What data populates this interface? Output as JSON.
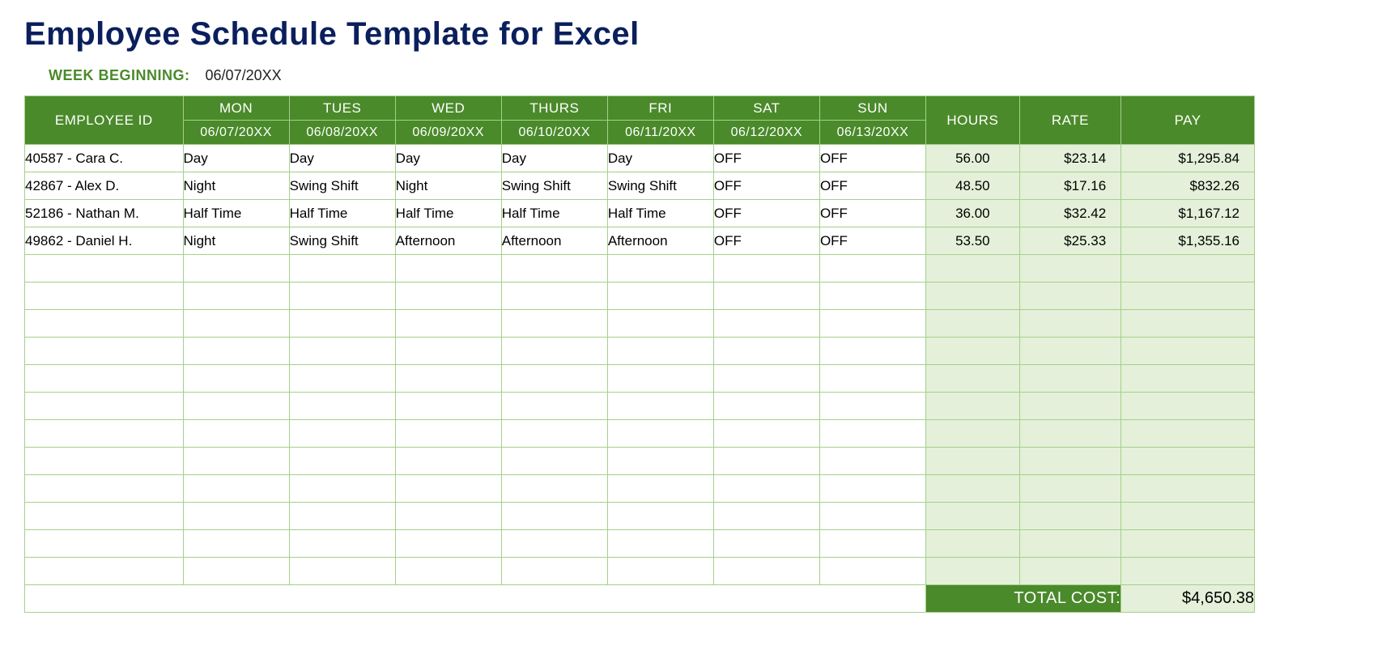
{
  "title": "Employee Schedule Template for Excel",
  "week_label": "WEEK BEGINNING:",
  "week_value": "06/07/20XX",
  "header": {
    "employee_id": "EMPLOYEE ID",
    "days": [
      {
        "name": "MON",
        "date": "06/07/20XX"
      },
      {
        "name": "TUES",
        "date": "06/08/20XX"
      },
      {
        "name": "WED",
        "date": "06/09/20XX"
      },
      {
        "name": "THURS",
        "date": "06/10/20XX"
      },
      {
        "name": "FRI",
        "date": "06/11/20XX"
      },
      {
        "name": "SAT",
        "date": "06/12/20XX"
      },
      {
        "name": "SUN",
        "date": "06/13/20XX"
      }
    ],
    "hours": "HOURS",
    "rate": "RATE",
    "pay": "PAY"
  },
  "rows": [
    {
      "employee": "40587 - Cara C.",
      "shifts": [
        "Day",
        "Day",
        "Day",
        "Day",
        "Day",
        "OFF",
        "OFF"
      ],
      "hours": "56.00",
      "rate": "$23.14",
      "pay": "$1,295.84"
    },
    {
      "employee": "42867 - Alex D.",
      "shifts": [
        "Night",
        "Swing Shift",
        "Night",
        "Swing Shift",
        "Swing Shift",
        "OFF",
        "OFF"
      ],
      "hours": "48.50",
      "rate": "$17.16",
      "pay": "$832.26"
    },
    {
      "employee": "52186 - Nathan M.",
      "shifts": [
        "Half Time",
        "Half Time",
        "Half Time",
        "Half Time",
        "Half Time",
        "OFF",
        "OFF"
      ],
      "hours": "36.00",
      "rate": "$32.42",
      "pay": "$1,167.12"
    },
    {
      "employee": "49862 - Daniel H.",
      "shifts": [
        "Night",
        "Swing Shift",
        "Afternoon",
        "Afternoon",
        "Afternoon",
        "OFF",
        "OFF"
      ],
      "hours": "53.50",
      "rate": "$25.33",
      "pay": "$1,355.16"
    }
  ],
  "empty_rows": 12,
  "total_label": "TOTAL COST:",
  "total_value": "$4,650.38"
}
